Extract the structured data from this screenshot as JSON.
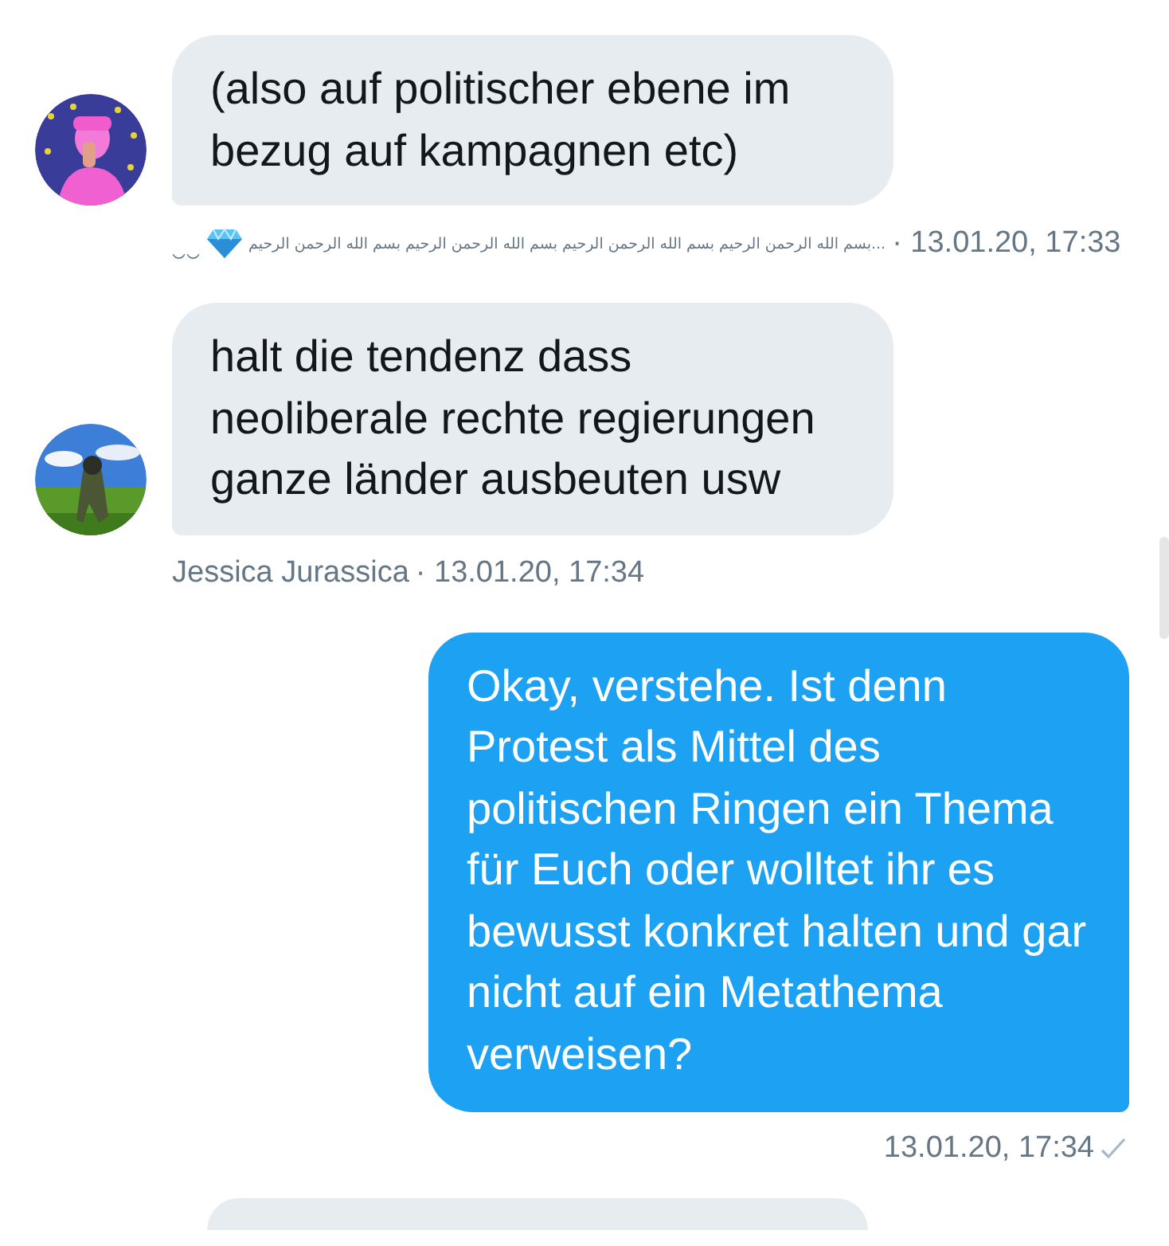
{
  "messages": [
    {
      "kind": "received",
      "text": "(also auf politischer ebene im bezug auf kampagnen etc)",
      "sender_decor": "‿‿",
      "sender_badge": {
        "kind": "gem"
      },
      "sender": "بسم الله الرحمن الرحيم بسم الله الرحمن الرحيم بسم الله الرحمن الرحيم بسم الله الرحمن الرحيم...",
      "time": "· 13.01.20, 17:33"
    },
    {
      "kind": "received",
      "text": "halt die tendenz dass neoliberale rechte regierungen ganze länder ausbeuten usw",
      "sender": "Jessica Jurassica",
      "time": "· 13.01.20, 17:34"
    },
    {
      "kind": "sent",
      "text": "Okay, verstehe. Ist denn Protest als Mittel des politischen Ringen ein Thema für Euch oder wolltet ihr es bewusst konkret halten und gar nicht auf ein Metathema verweisen?",
      "time": "13.01.20, 17:34",
      "read": true
    },
    {
      "kind": "partial"
    }
  ]
}
